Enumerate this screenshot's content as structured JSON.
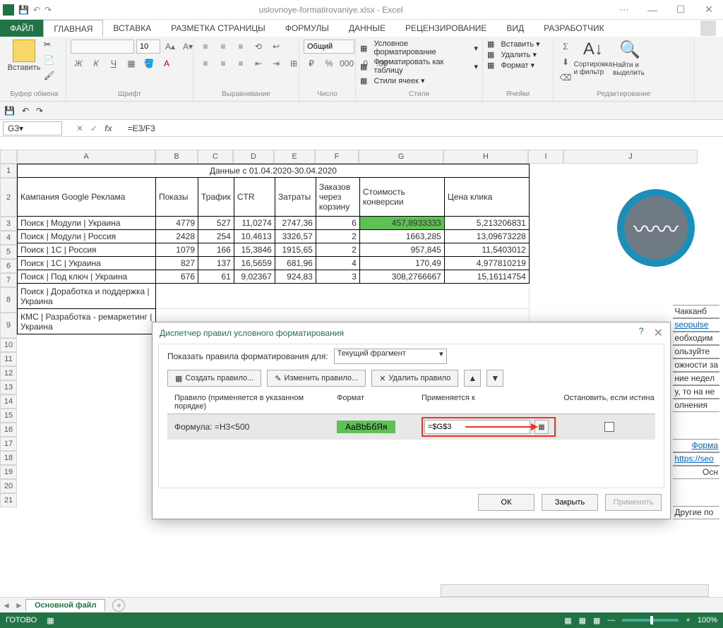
{
  "title": "uslovnoye-formatirovaniye.xlsx - Excel",
  "menu": {
    "file": "ФАЙЛ",
    "home": "ГЛАВНАЯ",
    "insert": "ВСТАВКА",
    "pagelayout": "РАЗМЕТКА СТРАНИЦЫ",
    "formulas": "ФОРМУЛЫ",
    "data": "ДАННЫЕ",
    "review": "РЕЦЕНЗИРОВАНИЕ",
    "view": "ВИД",
    "dev": "РАЗРАБОТЧИК"
  },
  "ribbon": {
    "paste": "Вставить",
    "clipboard": "Буфер обмена",
    "font_group": "Шрифт",
    "font_size": "10",
    "align_group": "Выравнивание",
    "number_group": "Число",
    "number_fmt": "Общий",
    "cond_fmt": "Условное форматирование",
    "fmt_table": "Форматировать как таблицу",
    "cell_styles": "Стили ячеек",
    "styles_group": "Стили",
    "insert_btn": "Вставить",
    "delete_btn": "Удалить",
    "format_btn": "Формат",
    "cells_group": "Ячейки",
    "sort_filter": "Сортировка и фильтр",
    "find_select": "Найти и выделить",
    "editing": "Редактирование"
  },
  "namebox": "G3",
  "formula": "=E3/F3",
  "cols": {
    "A": "A",
    "B": "B",
    "C": "C",
    "D": "D",
    "E": "E",
    "F": "F",
    "G": "G",
    "H": "H",
    "I": "I",
    "J": "J"
  },
  "headers": {
    "title": "Данные с 01.04.2020-30.04.2020",
    "a": "Кампания Google Реклама",
    "b": "Показы",
    "c": "Трафик",
    "d": "CTR",
    "e": "Затраты",
    "f": "Заказов через корзину",
    "g": "Стоимость конверсии",
    "h": "Цена клика"
  },
  "rows": [
    {
      "a": "Поиск | Модули | Украина",
      "b": "4779",
      "c": "527",
      "d": "11,0274",
      "e": "2747,36",
      "f": "6",
      "g": "457,8933333",
      "h": "5,213206831"
    },
    {
      "a": "Поиск | Модули | Россия",
      "b": "2428",
      "c": "254",
      "d": "10,4613",
      "e": "3326,57",
      "f": "2",
      "g": "1663,285",
      "h": "13,09673228"
    },
    {
      "a": "Поиск | 1С | Россия",
      "b": "1079",
      "c": "166",
      "d": "15,3846",
      "e": "1915,65",
      "f": "2",
      "g": "957,845",
      "h": "11,5403012"
    },
    {
      "a": "Поиск | 1С | Украина",
      "b": "827",
      "c": "137",
      "d": "16,5659",
      "e": "681,96",
      "f": "4",
      "g": "170,49",
      "h": "4,977810219"
    },
    {
      "a": "Поиск | Под ключ | Украина",
      "b": "676",
      "c": "61",
      "d": "9,02367",
      "e": "924,83",
      "f": "3",
      "g": "308,2766667",
      "h": "15,16114754"
    }
  ],
  "row8": "Поиск | Доработка и поддержка | Украина",
  "row9": "КМС | Разработка - ремаркетинг | Украина",
  "right_text": {
    "r8": "Чакканб",
    "r9link": "seopulse",
    "r10a": "еобходим",
    "r10b": "ользуйте",
    "r10c": "ожности за",
    "r10d": "ние недел",
    "r10e": "у, то на не",
    "r10f": "олнения",
    "r13": "Форма",
    "r14": "https://seo",
    "r15": "Осн",
    "r18": "Другие по"
  },
  "dialog": {
    "title": "Диспетчер правил условного форматирования",
    "show_for": "Показать правила форматирования для:",
    "select_val": "Текущий фрагмент",
    "new_rule": "Создать правило...",
    "edit_rule": "Изменить правило...",
    "del_rule": "Удалить правило",
    "col_rule": "Правило (применяется в указанном порядке)",
    "col_fmt": "Формат",
    "col_applies": "Применяется к",
    "col_stop": "Остановить, если истина",
    "rule_text": "Формула: =H3<500",
    "preview": "АаВbБбЯя",
    "applies": "=$G$3",
    "ok": "ОК",
    "close": "Закрыть",
    "apply": "Применить"
  },
  "sheet_tab": "Основной файл",
  "status": "ГОТОВО",
  "zoom": "100%"
}
